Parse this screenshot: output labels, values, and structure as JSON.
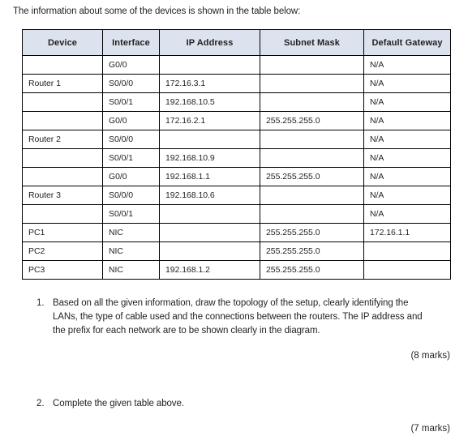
{
  "intro": "The information about some of the devices is shown in the table below:",
  "table": {
    "headers": [
      "Device",
      "Interface",
      "IP Address",
      "Subnet Mask",
      "Default Gateway"
    ],
    "rows": [
      {
        "device": "",
        "interface": "G0/0",
        "ip": "",
        "mask": "",
        "gateway": "N/A"
      },
      {
        "device": "Router 1",
        "interface": "S0/0/0",
        "ip": "172.16.3.1",
        "mask": "",
        "gateway": "N/A"
      },
      {
        "device": "",
        "interface": "S0/0/1",
        "ip": "192.168.10.5",
        "mask": "",
        "gateway": "N/A"
      },
      {
        "device": "",
        "interface": "G0/0",
        "ip": "172.16.2.1",
        "mask": "255.255.255.0",
        "gateway": "N/A"
      },
      {
        "device": "Router 2",
        "interface": "S0/0/0",
        "ip": "",
        "mask": "",
        "gateway": "N/A"
      },
      {
        "device": "",
        "interface": "S0/0/1",
        "ip": "192.168.10.9",
        "mask": "",
        "gateway": "N/A"
      },
      {
        "device": "",
        "interface": "G0/0",
        "ip": "192.168.1.1",
        "mask": "255.255.255.0",
        "gateway": "N/A"
      },
      {
        "device": "Router 3",
        "interface": "S0/0/0",
        "ip": "192.168.10.6",
        "mask": "",
        "gateway": "N/A"
      },
      {
        "device": "",
        "interface": "S0/0/1",
        "ip": "",
        "mask": "",
        "gateway": "N/A"
      },
      {
        "device": "PC1",
        "interface": "NIC",
        "ip": "",
        "mask": "255.255.255.0",
        "gateway": "172.16.1.1"
      },
      {
        "device": "PC2",
        "interface": "NIC",
        "ip": "",
        "mask": "255.255.255.0",
        "gateway": ""
      },
      {
        "device": "PC3",
        "interface": "NIC",
        "ip": "192.168.1.2",
        "mask": "255.255.255.0",
        "gateway": ""
      }
    ]
  },
  "questions": [
    {
      "number": "1.",
      "text": "Based on all the given information, draw the topology of the setup, clearly identifying the LANs, the type of cable used and the connections between the routers. The IP address and the prefix for each network are to be shown clearly in the diagram.",
      "marks": "(8 marks)"
    },
    {
      "number": "2.",
      "text": "Complete the given table above.",
      "marks": "(7 marks)"
    }
  ],
  "colors": {
    "header_fill": "#dce3ee",
    "border": "#000000",
    "text": "#231f20",
    "page_background": "#ffffff"
  }
}
